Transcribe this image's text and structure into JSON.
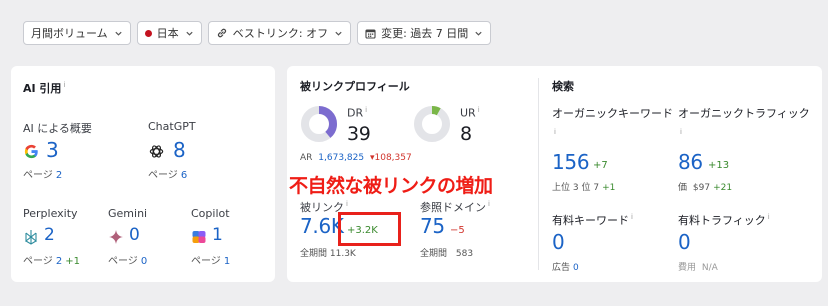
{
  "toolbar": {
    "volume": "月間ボリューム",
    "country": "日本",
    "best_link": "ベストリンク: オフ",
    "change": "変更: 過去 7 日間"
  },
  "ai_citations": {
    "title": "AI 引用",
    "info": "i",
    "overview": {
      "label": "AI による概要",
      "value": "3",
      "pages_label": "ページ",
      "pages": "2"
    },
    "chatgpt": {
      "label": "ChatGPT",
      "value": "8",
      "pages_label": "ページ",
      "pages": "6"
    },
    "perplexity": {
      "label": "Perplexity",
      "value": "2",
      "pages_label": "ページ",
      "pages": "2",
      "delta": "+1"
    },
    "gemini": {
      "label": "Gemini",
      "value": "0",
      "pages_label": "ページ",
      "pages": "0"
    },
    "copilot": {
      "label": "Copilot",
      "value": "1",
      "pages_label": "ページ",
      "pages": "1"
    }
  },
  "backlink_profile": {
    "title": "被リンクプロフィール",
    "dr": {
      "label": "DR",
      "value": "39",
      "ring_fraction": 0.39,
      "ring_color": "#7c6ccf"
    },
    "ur": {
      "label": "UR",
      "value": "8",
      "ring_fraction": 0.08,
      "ring_color": "#7ab648"
    },
    "ar": {
      "label": "AR",
      "value": "1,673,825",
      "delta": "▾108,357"
    },
    "backlinks": {
      "label": "被リンク",
      "value": "7.6K",
      "delta": "+3.2K",
      "all_time_label": "全期間",
      "all_time": "11.3K"
    },
    "ref_domains": {
      "label": "参照ドメイン",
      "value": "75",
      "delta": "−5",
      "all_time_label": "全期間",
      "all_time": "583"
    }
  },
  "search": {
    "title": "検索",
    "organic_keywords": {
      "label": "オーガニックキーワード",
      "value": "156",
      "delta": "+7",
      "sub_label": "上位 3 位",
      "sub_value": "7",
      "sub_delta": "+1"
    },
    "organic_traffic": {
      "label": "オーガニックトラフィック",
      "value": "86",
      "delta": "+13",
      "sub_label": "価",
      "sub_value": "$97",
      "sub_delta": "+21"
    },
    "paid_keywords": {
      "label": "有料キーワード",
      "value": "0",
      "sub_label": "広告",
      "sub_value": "0"
    },
    "paid_traffic": {
      "label": "有料トラフィック",
      "value": "0",
      "sub_label": "費用",
      "sub_value": "N/A"
    }
  },
  "annotation": {
    "text": "不自然な被リンクの増加",
    "color": "#ef1d16"
  }
}
